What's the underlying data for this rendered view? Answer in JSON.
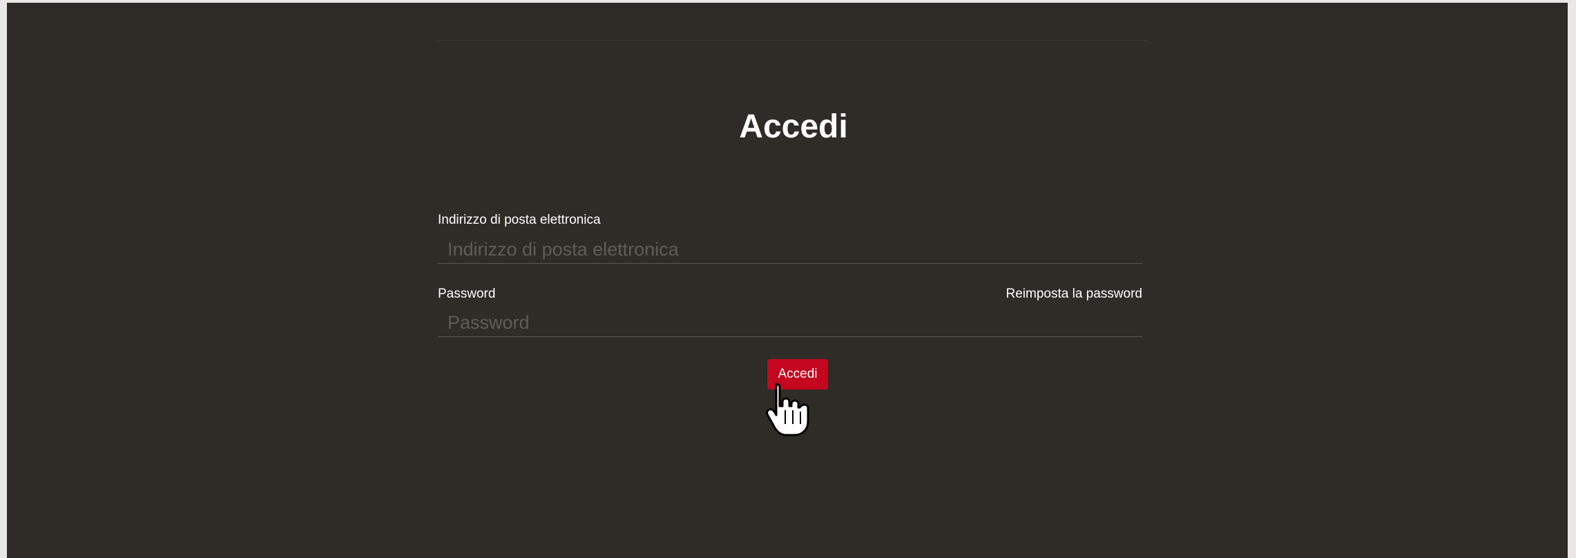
{
  "form": {
    "title": "Accedi",
    "email": {
      "label": "Indirizzo di posta elettronica",
      "placeholder": "Indirizzo di posta elettronica",
      "value": ""
    },
    "password": {
      "label": "Password",
      "placeholder": "Password",
      "value": "",
      "reset_link": "Reimposta la password"
    },
    "submit_label": "Accedi"
  },
  "colors": {
    "background": "#2f2b27",
    "accent": "#c4061e",
    "text": "#ffffff"
  },
  "icons": {
    "pointer": "hand-pointer-cursor-icon"
  }
}
